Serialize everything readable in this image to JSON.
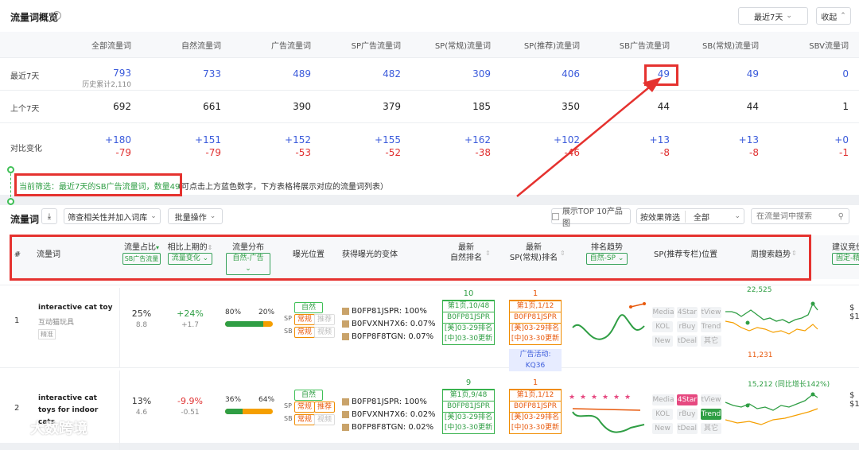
{
  "overview": {
    "title": "流量词概览",
    "period_select": "最近7天",
    "collapse_btn": "收起",
    "columns": [
      "全部流量词",
      "自然流量词",
      "广告流量词",
      "SP广告流量词",
      "SP(常规)流量词",
      "SP(推荐)流量词",
      "SB广告流量词",
      "SB(常规)流量词",
      "SBV流量词"
    ],
    "rows": [
      {
        "label": "最近7天",
        "values": [
          "793",
          "733",
          "489",
          "482",
          "309",
          "406",
          "49",
          "49",
          "0"
        ],
        "sub": "历史累计2,110"
      },
      {
        "label": "上个7天",
        "values": [
          "692",
          "661",
          "390",
          "379",
          "185",
          "350",
          "44",
          "44",
          "1"
        ]
      },
      {
        "label": "对比变化",
        "up": [
          "+180",
          "+151",
          "+152",
          "+155",
          "+162",
          "+102",
          "+13",
          "+13",
          "+0"
        ],
        "down": [
          "-79",
          "-79",
          "-53",
          "-52",
          "-38",
          "-46",
          "-8",
          "-8",
          "-1"
        ]
      }
    ]
  },
  "filter": {
    "highlight": "当前筛选：最近7天的SB广告流量词，数量49",
    "note": "（可点击上方蓝色数字，下方表格将展示对应的流量词列表）"
  },
  "toolbar": {
    "title": "流量词",
    "add_to_lib": "筛查相关性并加入词库",
    "batch": "批量操作",
    "top10": "展示TOP 10产品图",
    "filter_by": "按效果筛选",
    "filter_all": "全部",
    "search_placeholder": "在流量词中搜索"
  },
  "table": {
    "headers": {
      "idx": "#",
      "kw": "流量词",
      "share": "流量占比",
      "share_sel": "SB广告流量",
      "change": "相比上期的",
      "change_sel": "流量变化",
      "dist": "流量分布",
      "dist_sel": "自然-广告",
      "exposure": "曝光位置",
      "variants": "获得曝光的变体",
      "nat_rank": "最新\n自然排名",
      "sp_rank": "最新\nSP(常规)排名",
      "trend": "排名趋势",
      "trend_sel": "自然-SP",
      "sp_rec": "SP(推荐专栏)位置",
      "weekly": "周搜索趋势",
      "suggest": "建议竞价",
      "suggest_sel": "固定-精确"
    },
    "rows": [
      {
        "idx": "1",
        "kw": "interactive cat toy",
        "kw_cn": "互动猫玩具",
        "tag": "精准",
        "share": "25%",
        "share_sub": "8.8",
        "change": "+24%",
        "change_sub": "+1.7",
        "dist_l": "80%",
        "dist_r": "20%",
        "dist_fill": 0.8,
        "exp_nat": "自然",
        "exp_sp_label": "SP",
        "exp_sp1": "常规",
        "exp_sp2": "推荐",
        "exp_sb_label": "SB",
        "exp_sb1": "常规",
        "exp_sb2": "视频",
        "variants": [
          "B0FP81JSPR: 100%",
          "B0FVXNH7X6: 0.07%",
          "B0FP8F8TGN: 0.07%"
        ],
        "nat_rank": "10",
        "nat_lines": [
          "第1页,10/48",
          "B0FP81JSPR",
          "[美]03-29排名",
          "[中]03-30更新"
        ],
        "sp_rank": "1",
        "sp_lines": [
          "第1页,1/12",
          "B0FP81JSPR",
          "[美]03-29排名",
          "[中]03-30更新"
        ],
        "ad_activity": "广告活动: KQ36",
        "chips": [
          "Media",
          "4Star",
          "tView",
          "KOL",
          "rBuy",
          "Trend",
          "New",
          "tDeal",
          "其它"
        ],
        "weekly_top": "22,525",
        "weekly_bottom": "11,231"
      },
      {
        "idx": "2",
        "kw": "interactive cat toys for indoor cats",
        "kw_cn": "",
        "tag": "",
        "share": "13%",
        "share_sub": "4.6",
        "change": "-9.9%",
        "change_sub": "-0.51",
        "dist_l": "36%",
        "dist_r": "64%",
        "dist_fill": 0.36,
        "exp_nat": "自然",
        "exp_sp_label": "SP",
        "exp_sp1": "常规",
        "exp_sp2": "推荐",
        "exp_sb_label": "SB",
        "exp_sb1": "常规",
        "exp_sb2": "视频",
        "variants": [
          "B0FP81JSPR: 100%",
          "B0FVXNH7X6: 0.02%",
          "B0FP8F8TGN: 0.02%"
        ],
        "nat_rank": "9",
        "nat_lines": [
          "第1页,9/48",
          "B0FP81JSPR",
          "[美]03-29排名",
          "[中]03-30更新"
        ],
        "sp_rank": "1",
        "sp_lines": [
          "第1页,1/12",
          "B0FP81JSPR",
          "[美]03-29排名",
          "[中]03-30更新"
        ],
        "chips": [
          "Media",
          "4Star",
          "tView",
          "KOL",
          "rBuy",
          "Trend",
          "New",
          "tDeal",
          "其它"
        ],
        "weekly_top": "15,212 (同比增长142%)"
      }
    ]
  },
  "watermark": "大数跨境",
  "colors": {
    "accent_blue": "#3b5bdb",
    "green": "#2f9e44",
    "red_annotation": "#e5322f",
    "orange": "#e8590c"
  }
}
